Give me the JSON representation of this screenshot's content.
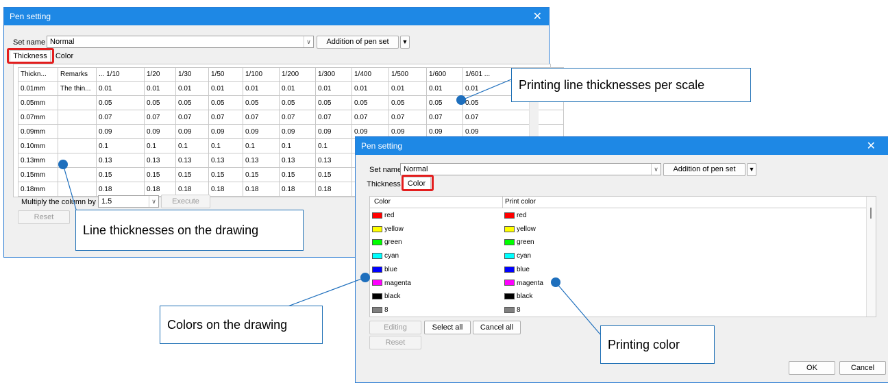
{
  "dialog1": {
    "title": "Pen setting",
    "close": "✕",
    "set_name_label": "Set name",
    "set_name_value": "Normal",
    "addition_button": "Addition of pen set",
    "tabs": [
      "Thickness",
      "Color"
    ],
    "columns": [
      "Thickn...",
      "Remarks",
      "... 1/10",
      "1/20",
      "1/30",
      "1/50",
      "1/100",
      "1/200",
      "1/300",
      "1/400",
      "1/500",
      "1/600",
      "1/601 ..."
    ],
    "rows": [
      [
        "0.01mm",
        "The thin...",
        "0.01",
        "0.01",
        "0.01",
        "0.01",
        "0.01",
        "0.01",
        "0.01",
        "0.01",
        "0.01",
        "0.01",
        "0.01"
      ],
      [
        "0.05mm",
        "",
        "0.05",
        "0.05",
        "0.05",
        "0.05",
        "0.05",
        "0.05",
        "0.05",
        "0.05",
        "0.05",
        "0.05",
        "0.05"
      ],
      [
        "0.07mm",
        "",
        "0.07",
        "0.07",
        "0.07",
        "0.07",
        "0.07",
        "0.07",
        "0.07",
        "0.07",
        "0.07",
        "0.07",
        "0.07"
      ],
      [
        "0.09mm",
        "",
        "0.09",
        "0.09",
        "0.09",
        "0.09",
        "0.09",
        "0.09",
        "0.09",
        "0.09",
        "0.09",
        "0.09",
        "0.09"
      ],
      [
        "0.10mm",
        "",
        "0.1",
        "0.1",
        "0.1",
        "0.1",
        "0.1",
        "0.1",
        "0.1",
        "",
        "",
        "",
        ""
      ],
      [
        "0.13mm",
        "",
        "0.13",
        "0.13",
        "0.13",
        "0.13",
        "0.13",
        "0.13",
        "0.13",
        "",
        "",
        "",
        ""
      ],
      [
        "0.15mm",
        "",
        "0.15",
        "0.15",
        "0.15",
        "0.15",
        "0.15",
        "0.15",
        "0.15",
        "",
        "",
        "",
        ""
      ],
      [
        "0.18mm",
        "",
        "0.18",
        "0.18",
        "0.18",
        "0.18",
        "0.18",
        "0.18",
        "0.18",
        "",
        "",
        "",
        ""
      ]
    ],
    "multiply_label": "Multiply the column by",
    "multiply_value": "1.5",
    "execute_button": "Execute",
    "reset_button": "Reset"
  },
  "dialog2": {
    "title": "Pen setting",
    "close": "✕",
    "set_name_label": "Set name",
    "set_name_value": "Normal",
    "addition_button": "Addition of pen set",
    "tabs": [
      "Thickness",
      "Color"
    ],
    "col_color": "Color",
    "col_print": "Print color",
    "colors": [
      {
        "name": "red",
        "hex": "#ff0000",
        "print": "red",
        "print_hex": "#ff0000"
      },
      {
        "name": "yellow",
        "hex": "#ffff00",
        "print": "yellow",
        "print_hex": "#ffff00"
      },
      {
        "name": "green",
        "hex": "#00ff00",
        "print": "green",
        "print_hex": "#00ff00"
      },
      {
        "name": "cyan",
        "hex": "#00ffff",
        "print": "cyan",
        "print_hex": "#00ffff"
      },
      {
        "name": "blue",
        "hex": "#0000ff",
        "print": "blue",
        "print_hex": "#0000ff"
      },
      {
        "name": "magenta",
        "hex": "#ff00ff",
        "print": "magenta",
        "print_hex": "#ff00ff"
      },
      {
        "name": "black",
        "hex": "#000000",
        "print": "black",
        "print_hex": "#000000"
      },
      {
        "name": "8",
        "hex": "#808080",
        "print": "8",
        "print_hex": "#808080"
      }
    ],
    "editing_button": "Editing",
    "select_all_button": "Select all",
    "cancel_all_button": "Cancel all",
    "reset_button": "Reset",
    "ok_button": "OK",
    "cancel_button": "Cancel"
  },
  "callouts": {
    "printing_thickness": "Printing line thicknesses per scale",
    "line_thickness": "Line thicknesses on the drawing",
    "colors_drawing": "Colors on the drawing",
    "printing_color": "Printing color"
  },
  "accent_color": "#1e6fbd",
  "highlight_color": "#e31d1d"
}
